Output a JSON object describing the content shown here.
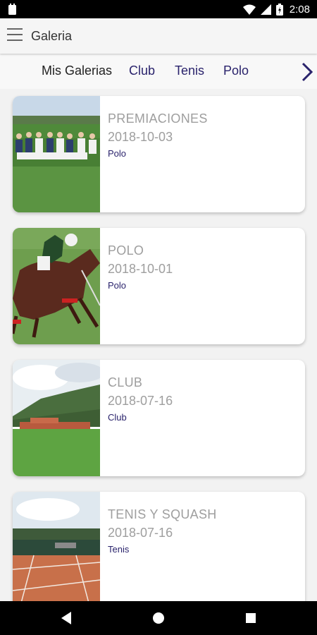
{
  "status_bar": {
    "time": "2:08"
  },
  "app_bar": {
    "title": "Galeria"
  },
  "tabs": [
    {
      "label": "Mis Galerias",
      "active": true
    },
    {
      "label": "Club"
    },
    {
      "label": "Tenis"
    },
    {
      "label": "Polo"
    }
  ],
  "galleries": [
    {
      "title": "PREMIACIONES",
      "date": "2018-10-03",
      "category": "Polo"
    },
    {
      "title": "POLO",
      "date": "2018-10-01",
      "category": "Polo"
    },
    {
      "title": "CLUB",
      "date": "2018-07-16",
      "category": "Club"
    },
    {
      "title": "TENIS Y SQUASH",
      "date": "2018-07-16",
      "category": "Tenis"
    }
  ],
  "colors": {
    "accent": "#2a236c",
    "muted_text": "#9e9e9e",
    "background": "#f2f2f2"
  },
  "icons": [
    "notification-icon",
    "wifi-icon",
    "signal-icon",
    "battery-icon",
    "menu-icon",
    "chevron-right-icon",
    "back-icon",
    "home-icon",
    "recents-icon"
  ]
}
